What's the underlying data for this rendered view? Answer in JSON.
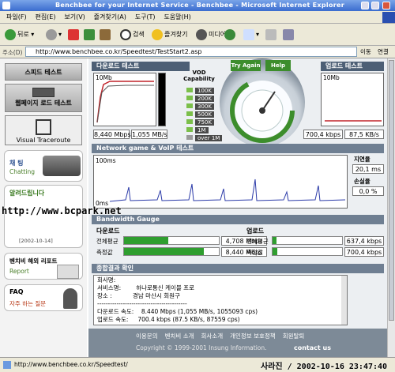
{
  "window": {
    "title": "Benchbee for your Internet Service - Benchbee - Microsoft Internet Explorer"
  },
  "menu": [
    "파일(F)",
    "편집(E)",
    "보기(V)",
    "즐겨찾기(A)",
    "도구(T)",
    "도움말(H)"
  ],
  "toolbar": {
    "back": "뒤로",
    "search": "검색",
    "favorites": "즐겨찾기",
    "media": "미디어"
  },
  "address": {
    "label": "주소(D)",
    "url": "http://www.benchbee.co.kr/Speedtest/TestStart2.asp",
    "go": "이동",
    "links": "연결"
  },
  "sidebar": {
    "speed_test": "스피드 테스트",
    "webpage_load": "웹페이지 로드 테스트",
    "visual_traceroute": "Visual Traceroute",
    "chatting": "채 팅",
    "chatting_en": "Chatting",
    "notice_title": "알려드립니다",
    "notice_date": "[2002-10-14]",
    "overseas": "벤치비 해외 리포트",
    "report": "Report",
    "faq": "FAQ",
    "faq_sub": "자주 하는 질문"
  },
  "download": {
    "title": "다운로드 테스트",
    "axis_top": "10Mb",
    "speed_kbps": "8,440 Mbps",
    "speed_bytes": "1,055 MB/s"
  },
  "vod": {
    "title": "VOD Capability",
    "levels": [
      "100K",
      "200K",
      "300K",
      "500K",
      "750K",
      "1M",
      "over 1M"
    ]
  },
  "gauge": {
    "try_again": "Try Again",
    "help": "Help",
    "scale": [
      "128K",
      "256K",
      "512K",
      "1M",
      "2M",
      "5M",
      "8M",
      "10M"
    ]
  },
  "upload": {
    "title": "업로드 테스트",
    "axis_top": "10Mb",
    "speed_kbps": "700,4 kbps",
    "speed_bytes": "87,5 KB/s"
  },
  "network": {
    "title": "Network game & VoIP 테스트",
    "axis_top": "100ms",
    "axis_bottom": "0ms",
    "latency_label": "지연율",
    "latency_value": "20,1 ms",
    "loss_label": "손실율",
    "loss_value": "0,0 %"
  },
  "bandwidth": {
    "title": "Bandwidth Gauge",
    "download": {
      "title": "다운로드",
      "avg_label": "전체평균",
      "avg_value": "4,708 Mbps",
      "avg_fraction": 0.47,
      "measured_label": "측정값",
      "measured_value": "8,440 Mbps",
      "measured_fraction": 0.84
    },
    "upload": {
      "title": "업로드",
      "avg_label": "전체평균",
      "avg_value": "637,4 kbps",
      "avg_fraction": 0.06,
      "measured_label": "측정값",
      "measured_value": "700,4 kbps",
      "measured_fraction": 0.07
    }
  },
  "results": {
    "title": "종합결과 확인",
    "lines": [
      "회사명:",
      "서비스명:        하나로통신 케이블 프로",
      "장소 :           경남 마산시 회원구",
      "------------------------------------------",
      "다운로드 속도:    8.440 Mbps (1,055 MB/s, 1055093 cps)",
      "업로드 속도:     700.4 kbps (87.5 KB/s, 87559 cps)"
    ]
  },
  "footer": {
    "links": [
      "이용문의",
      "벤치비 소개",
      "회사소개",
      "개인정보 보호정책",
      "회원탈퇴"
    ],
    "copyright": "Copyright © 1999-2001 Insung Information.",
    "contact": "contact us"
  },
  "status": {
    "url": "http://www.benchbee.co.kr/Speedtest/"
  },
  "watermark": {
    "site": "http://www.bcpark.net",
    "caption": "사라진 / 2002-10-16 23:47:40"
  }
}
